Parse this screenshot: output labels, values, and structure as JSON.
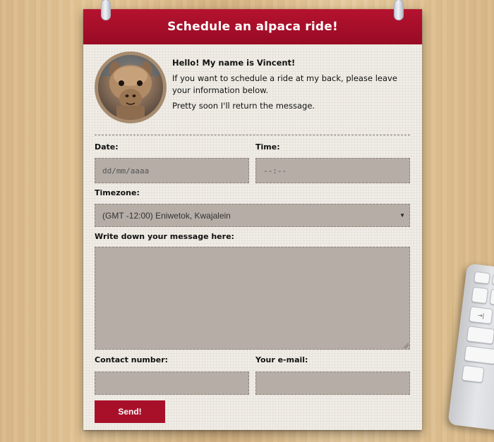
{
  "title": "Schedule an alpaca ride!",
  "intro": {
    "greeting": "Hello! My name is Vincent!",
    "line1": "If you want to schedule a ride at my back, please leave your information below.",
    "line2": "Pretty soon I'll return the message."
  },
  "form": {
    "date_label": "Date:",
    "date_placeholder": "dd/mm/aaaa",
    "time_label": "Time:",
    "time_placeholder": "--:--",
    "timezone_label": "Timezone:",
    "timezone_selected": "(GMT -12:00) Eniwetok, Kwajalein",
    "message_label": "Write down your message here:",
    "message_value": "",
    "contact_label": "Contact number:",
    "contact_value": "",
    "email_label": "Your e-mail:",
    "email_value": "",
    "send_label": "Send!"
  },
  "keyboard": {
    "keys": [
      "",
      "",
      "",
      "",
      "→|",
      "",
      "",
      "",
      "",
      ""
    ]
  },
  "colors": {
    "header": "#a8102a",
    "button": "#a8102a",
    "field_bg": "#b5ada6",
    "paper": "#f1ede6"
  }
}
